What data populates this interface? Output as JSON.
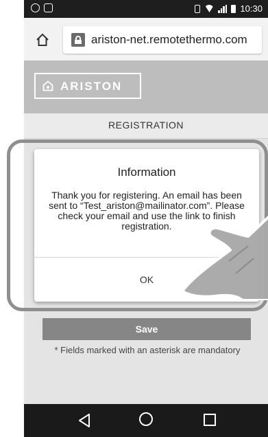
{
  "status_bar": {
    "time": "10:30"
  },
  "browser": {
    "url": "ariston-net.remotethermo.com"
  },
  "header": {
    "logo_text": "ARISTON",
    "page_title": "REGISTRATION"
  },
  "form": {
    "save_label": "Save",
    "mandatory_note": "* Fields marked with an asterisk are mandatory"
  },
  "dialog": {
    "title": "Information",
    "message": "Thank you for registering. An email has been sent to “Test_ariston@mailinator.com”. Please check your email and use the link to finish registration.",
    "ok_label": "OK"
  },
  "colors": {
    "status_bar": "#1e1e1e",
    "header": "#bdbdbd",
    "save_button": "#868686",
    "highlight_ring": "#8f8f8f"
  },
  "icons": {
    "home": "home-icon",
    "lock": "lock-icon",
    "back": "back-icon",
    "home_nav": "circle-home-icon",
    "recents": "recents-icon"
  }
}
